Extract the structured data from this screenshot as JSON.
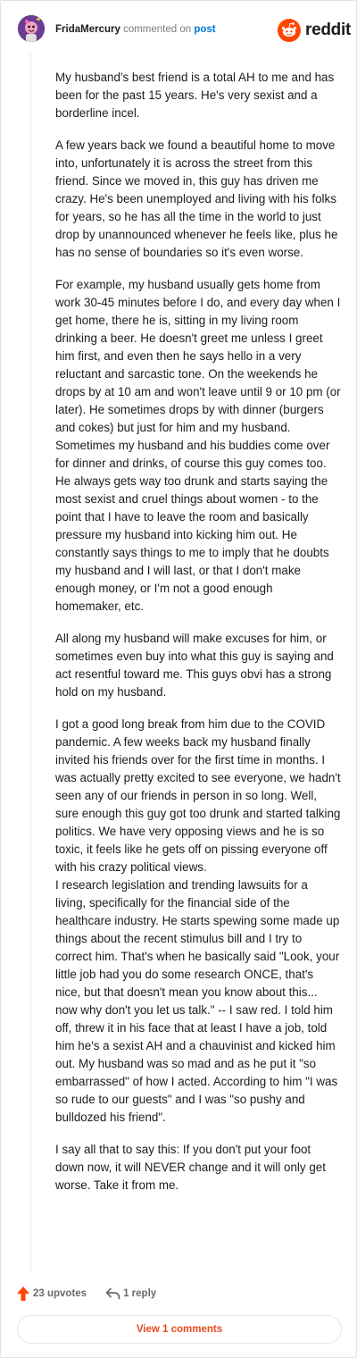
{
  "header": {
    "username": "FridaMercury",
    "action_text": "commented on",
    "target_text": "post",
    "brand_name": "reddit"
  },
  "icons": {
    "avatar": "avatar-icon",
    "brand": "reddit-logo-icon",
    "upvote": "upvote-arrow-icon",
    "reply": "reply-arrow-icon"
  },
  "colors": {
    "brand_orange": "#ff4500",
    "upvote_orange": "#ff4500",
    "link_blue": "#0079d3",
    "view_comments_text": "#e8491d"
  },
  "comment": {
    "paragraphs": [
      "My husband's best friend is a total AH to me and has been for the past 15 years. He's very sexist and a borderline incel.",
      "A few years back we found a beautiful home to move into, unfortunately it is across the street from this friend. Since we moved in, this guy has driven me crazy. He's been unemployed and living with his folks for years, so he has all the time in the world to just drop by unannounced whenever he feels like, plus he has no sense of boundaries so it's even worse.",
      "For example, my husband usually gets home from work 30-45 minutes before I do, and every day when I get home, there he is, sitting in my living room drinking a beer. He doesn't greet me unless I greet him first, and even then he says hello in a very reluctant and sarcastic tone. On the weekends he drops by at 10 am and won't leave until 9 or 10 pm (or later). He sometimes drops by with dinner (burgers and cokes) but just for him and my husband. Sometimes my husband and his buddies come over for dinner and drinks, of course this guy comes too. He always gets way too drunk and starts saying the most sexist and cruel things about women - to the point that I have to leave the room and basically pressure my husband into kicking him out. He constantly says things to me to imply that he doubts my husband and I will last, or that I don't make enough money, or I'm not a good enough homemaker, etc.",
      "All along my husband will make excuses for him, or sometimes even buy into what this guy is saying and act resentful toward me. This guys obvi has a strong hold on my husband.",
      "I got a good long break from him due to the COVID pandemic. A few weeks back my husband finally invited his friends over for the first time in months. I was actually pretty excited to see everyone, we hadn't seen any of our friends in person in so long. Well, sure enough this guy got too drunk and started talking politics. We have very opposing views and he is so toxic, it feels like he gets off on pissing everyone off with his crazy political views.\nI research legislation and trending lawsuits for a living, specifically for the financial side of the healthcare industry. He starts spewing some made up things about the recent stimulus bill and I try to correct him. That's when he basically said \"Look, your little job had you do some research ONCE, that's nice, but that doesn't mean you know about this... now why don't you let us talk.\" -- I saw red. I told him off, threw it in his face that at least I have a job, told him he's a sexist AH and a chauvinist and kicked him out. My husband was so mad and as he put it \"so embarrassed\" of how I acted. According to him \"I was so rude to our guests\" and I was \"so pushy and bulldozed his friend\".",
      "I say all that to say this: If you don't put your foot down now, it will NEVER change and it will only get worse. Take it from me."
    ]
  },
  "footer": {
    "upvotes_label": "23 upvotes",
    "reply_label": "1 reply",
    "view_comments_label": "View 1 comments"
  }
}
